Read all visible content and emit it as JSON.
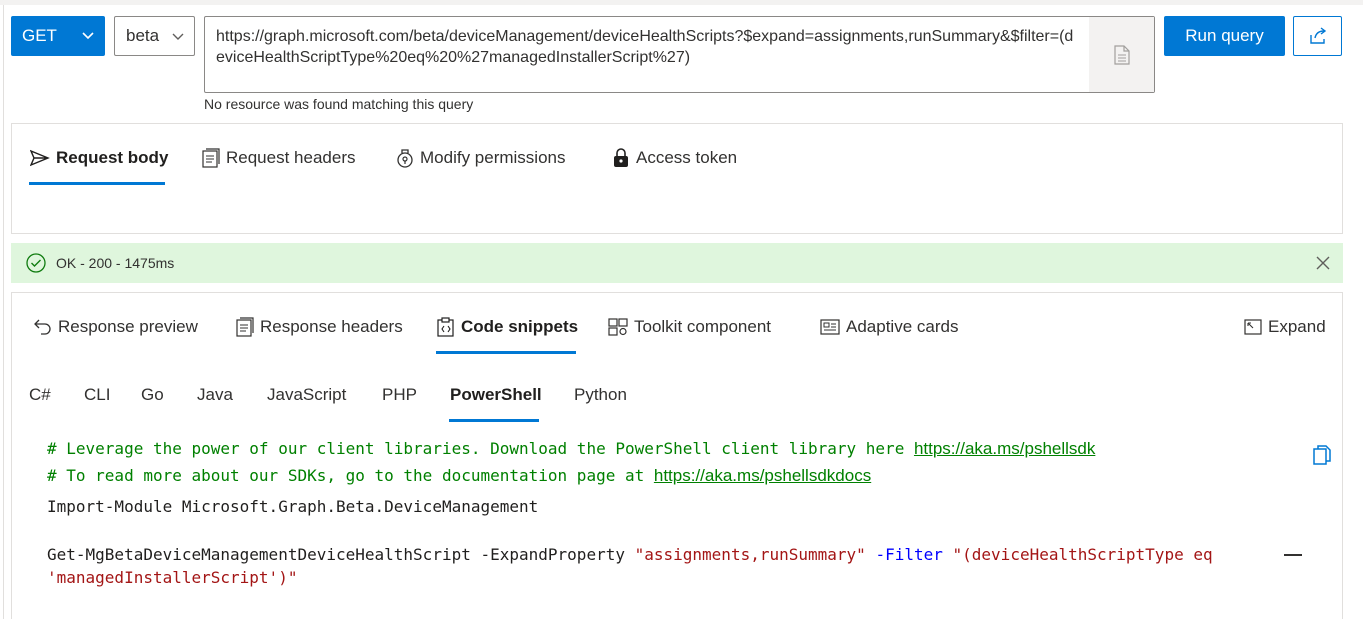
{
  "query": {
    "method": "GET",
    "version": "beta",
    "url": "https://graph.microsoft.com/beta/deviceManagement/deviceHealthScripts?$expand=assignments,runSummary&$filter=(deviceHealthScriptType%20eq%20%27managedInstallerScript%27)",
    "error_message": "No resource was found matching this query",
    "run_label": "Run query"
  },
  "request_tabs": [
    {
      "label": "Request body",
      "icon": "send-icon"
    },
    {
      "label": "Request headers",
      "icon": "headers-icon"
    },
    {
      "label": "Modify permissions",
      "icon": "permissions-icon"
    },
    {
      "label": "Access token",
      "icon": "lock-icon"
    }
  ],
  "status": {
    "text": "OK - 200 - 1475ms",
    "color": "#dff6dd"
  },
  "response_tabs": [
    {
      "label": "Response preview",
      "icon": "undo-icon"
    },
    {
      "label": "Response headers",
      "icon": "headers-icon"
    },
    {
      "label": "Code snippets",
      "icon": "code-clipboard-icon"
    },
    {
      "label": "Toolkit component",
      "icon": "toolkit-icon"
    },
    {
      "label": "Adaptive cards",
      "icon": "card-icon"
    }
  ],
  "expand_label": "Expand",
  "languages": [
    "C#",
    "CLI",
    "Go",
    "Java",
    "JavaScript",
    "PHP",
    "PowerShell",
    "Python"
  ],
  "active_language": "PowerShell",
  "code": {
    "comment1_prefix": "# Leverage the power of our client libraries. Download the PowerShell client library here ",
    "comment1_link": "https://aka.ms/pshellsdk",
    "comment2_prefix": "# To read more about our SDKs, go to the documentation page at ",
    "comment2_link": "https://aka.ms/pshellsdkdocs",
    "import_line": "Import-Module Microsoft.Graph.Beta.DeviceManagement",
    "cmdlet": "Get-MgBetaDeviceManagementDeviceHealthScript -ExpandProperty ",
    "expand_value": "\"assignments,runSummary\"",
    "filter_param": "-Filter",
    "filter_value_1": "\"(deviceHealthScriptType eq",
    "filter_value_2": "'managedInstallerScript')\""
  },
  "colors": {
    "accent": "#0078d4",
    "success_bg": "#dff6dd",
    "comment": "#008000",
    "string": "#a31515",
    "param": "#0000ff"
  }
}
